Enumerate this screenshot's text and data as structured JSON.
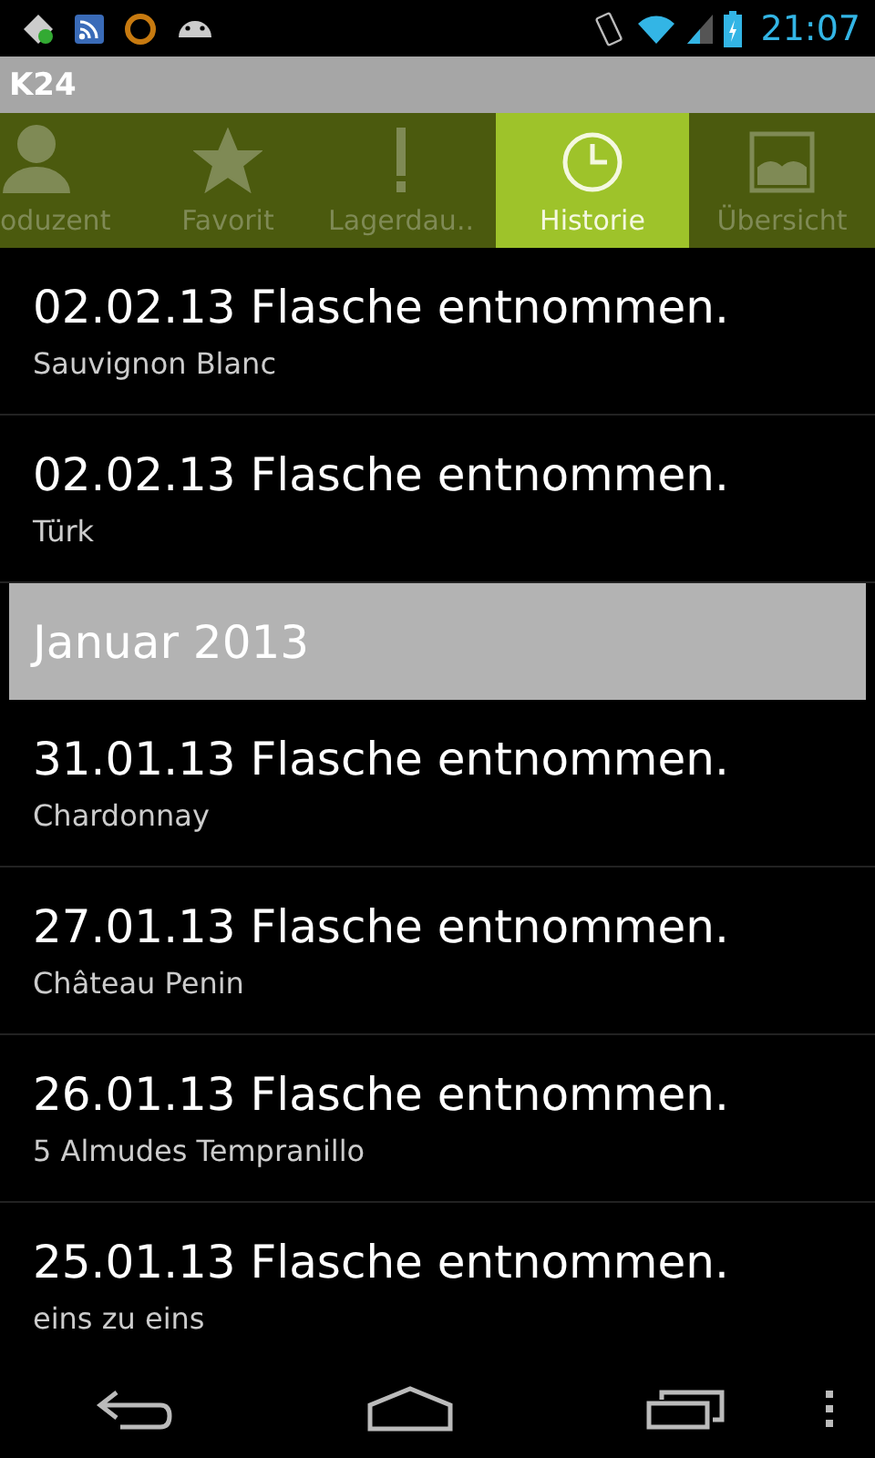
{
  "status_bar": {
    "time": "21:07"
  },
  "window": {
    "title": "K24"
  },
  "tabs": [
    {
      "label": "oduzent",
      "kind": "person",
      "selected": false
    },
    {
      "label": "Favorit",
      "kind": "star",
      "selected": false
    },
    {
      "label": "Lagerdau..",
      "kind": "alert",
      "selected": false
    },
    {
      "label": "Historie",
      "kind": "clock",
      "selected": true
    },
    {
      "label": "Übersicht",
      "kind": "image",
      "selected": false
    }
  ],
  "list": [
    {
      "kind": "entry",
      "title": "02.02.13 Flasche entnommen.",
      "subtitle": "Sauvignon Blanc"
    },
    {
      "kind": "entry",
      "title": "02.02.13 Flasche entnommen.",
      "subtitle": "Türk"
    },
    {
      "kind": "header",
      "title": "Januar 2013"
    },
    {
      "kind": "entry",
      "title": "31.01.13 Flasche entnommen.",
      "subtitle": "Chardonnay"
    },
    {
      "kind": "entry",
      "title": "27.01.13 Flasche entnommen.",
      "subtitle": "Château Penin"
    },
    {
      "kind": "entry",
      "title": "26.01.13 Flasche entnommen.",
      "subtitle": "5 Almudes Tempranillo"
    },
    {
      "kind": "entry",
      "title": "25.01.13 Flasche entnommen.",
      "subtitle": "eins zu eins"
    }
  ]
}
